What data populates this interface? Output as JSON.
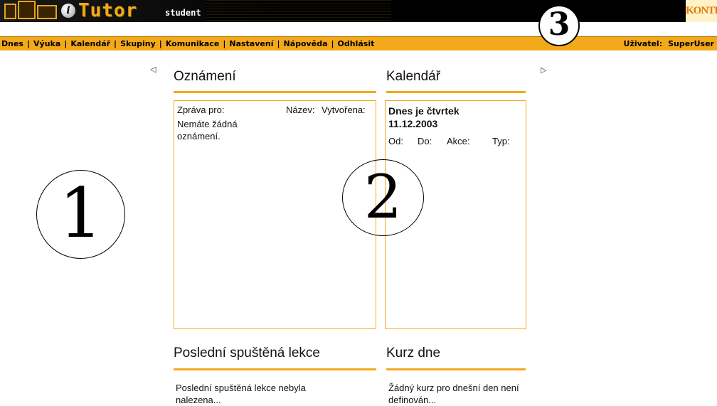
{
  "header": {
    "logo_word": "Tutor",
    "logo_i": "i",
    "logo_sub": "student",
    "brand": "KONTIS"
  },
  "annotations": {
    "circle1": "1",
    "circle2": "2",
    "circle3": "3"
  },
  "nav": {
    "items": [
      {
        "label": "Dnes"
      },
      {
        "label": "Výuka"
      },
      {
        "label": "Kalendář"
      },
      {
        "label": "Skupiny"
      },
      {
        "label": "Komunikace"
      },
      {
        "label": "Nastavení"
      },
      {
        "label": "Nápověda"
      },
      {
        "label": "Odhlásit"
      }
    ],
    "separator": "|",
    "user_label": "Uživatel:",
    "user_name": "SuperUser"
  },
  "arrows": {
    "left": "◁",
    "right": "▷"
  },
  "announcements": {
    "title": "Oznámení",
    "col_for": "Zpráva pro:",
    "col_name": "Název:",
    "col_created": "Vytvořena:",
    "empty": "Nemáte žádná oznámení."
  },
  "calendar": {
    "title": "Kalendář",
    "today": "Dnes je čtvrtek 11.12.2003",
    "col_from": "Od:",
    "col_to": "Do:",
    "col_action": "Akce:",
    "col_type": "Typ:"
  },
  "last_lesson": {
    "title": "Poslední spuštěná lekce",
    "text": "Poslední spuštěná lekce nebyla nalezena..."
  },
  "course_of_day": {
    "title": "Kurz dne",
    "text": "Žádný kurz pro dnešní den není definován..."
  },
  "colors": {
    "accent": "#f2a91c",
    "header_bg": "#000000",
    "brand": "#e27a00"
  }
}
